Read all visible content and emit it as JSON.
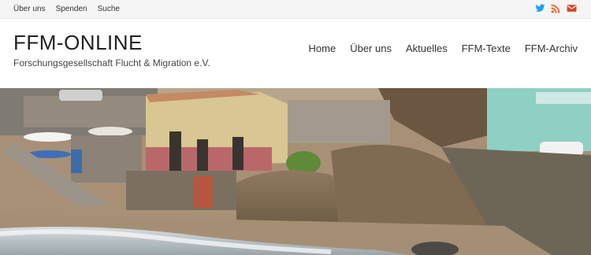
{
  "topbar": {
    "links": [
      "Über uns",
      "Spenden",
      "Suche"
    ],
    "social": [
      {
        "icon": "twitter-icon",
        "color": "#1da1f2"
      },
      {
        "icon": "rss-icon",
        "color": "#f26522"
      },
      {
        "icon": "envelope-icon",
        "color": "#d9452b"
      }
    ]
  },
  "header": {
    "title": "FFM-ONLINE",
    "description": "Forschungsgesellschaft Flucht & Migration e.V."
  },
  "nav": {
    "items": [
      "Home",
      "Über uns",
      "Aktuelles",
      "FFM-Texte",
      "FFM-Archiv"
    ]
  },
  "hero": {
    "image": "coastal-village-photo"
  }
}
